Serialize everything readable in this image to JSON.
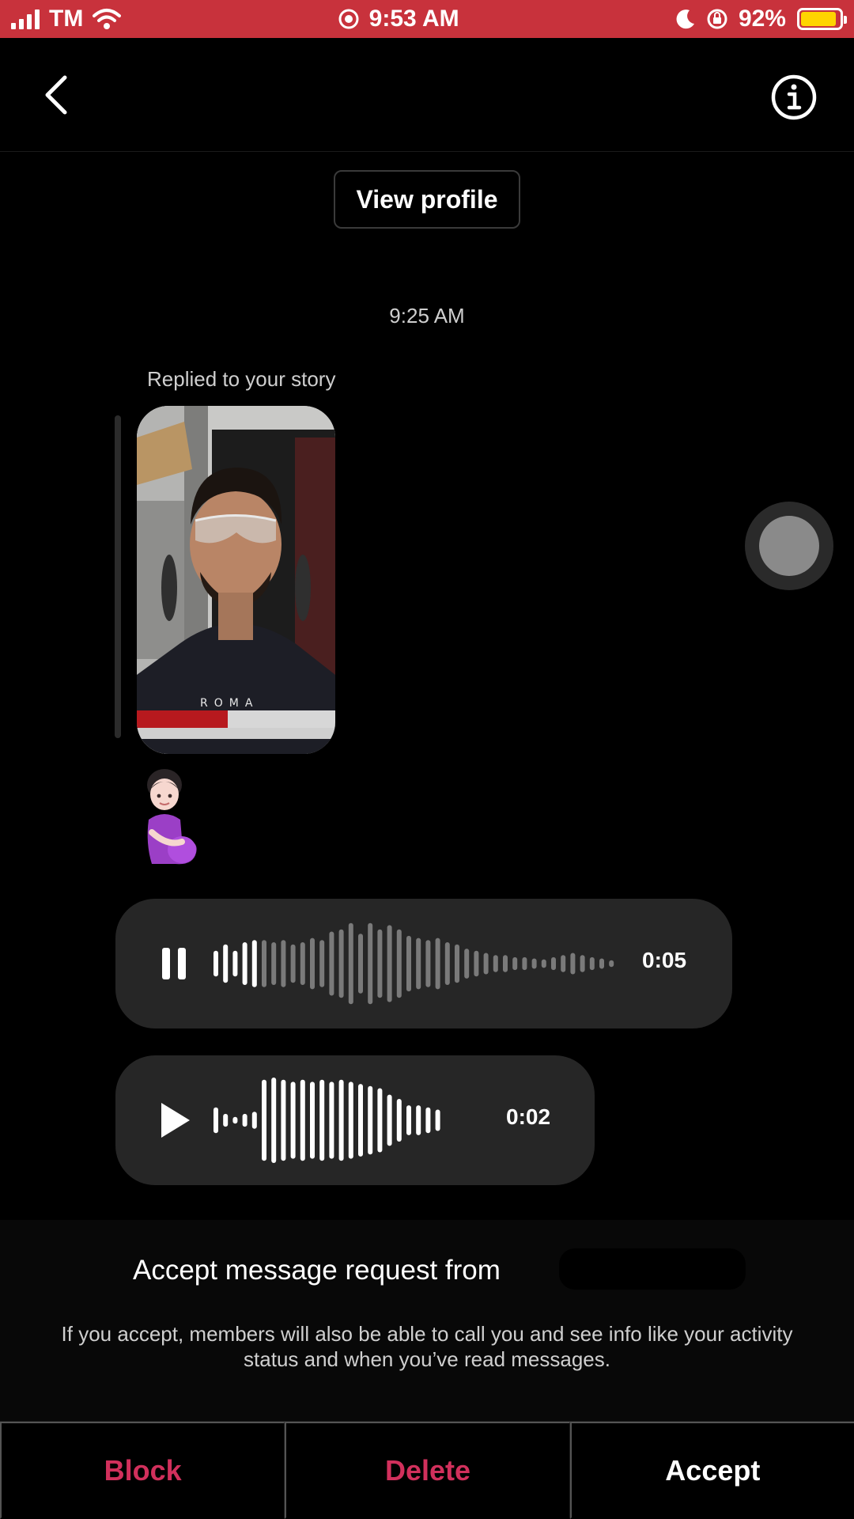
{
  "status_bar": {
    "carrier": "TM",
    "time": "9:53 AM",
    "battery": "92%",
    "battery_level": 0.92,
    "bg_color": "#c8323c",
    "icons": [
      "signal-icon",
      "wifi-icon",
      "location-icon",
      "moon-icon",
      "rotation-lock-icon",
      "battery-icon"
    ]
  },
  "header": {
    "back_icon": "chevron-left-icon",
    "info_icon": "info-icon"
  },
  "thread": {
    "view_profile_label": "View profile",
    "timestamp": "9:25 AM",
    "replied_label": "Replied to your story",
    "story_shirt_text": "ROMA",
    "sticker": "pregnant-woman-emoji"
  },
  "voice_messages": [
    {
      "state": "playing",
      "control_icon": "pause-icon",
      "duration": "0:05",
      "progress": 0.12
    },
    {
      "state": "paused",
      "control_icon": "play-icon",
      "duration": "0:02",
      "progress": 1.0
    }
  ],
  "request": {
    "title": "Accept message request from",
    "description": "If you accept, members will also be able to call you and see info like your activity status and when you’ve read messages."
  },
  "actions": {
    "block": "Block",
    "delete": "Delete",
    "accept": "Accept",
    "destructive_color": "#d1305c"
  }
}
